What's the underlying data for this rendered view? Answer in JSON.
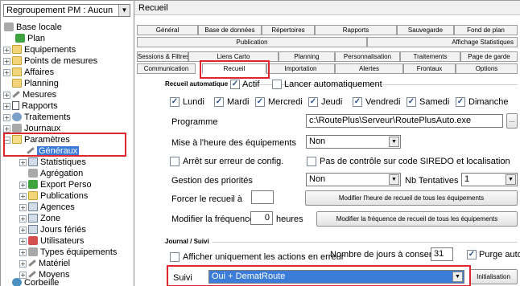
{
  "left": {
    "regroupement": "Regroupement PM : Aucun",
    "tree": [
      {
        "label": "Base locale"
      },
      {
        "label": "Plan"
      },
      {
        "label": "Equipements"
      },
      {
        "label": "Points de mesures"
      },
      {
        "label": "Affaires"
      },
      {
        "label": "Planning"
      },
      {
        "label": "Mesures"
      },
      {
        "label": "Rapports"
      },
      {
        "label": "Traitements"
      },
      {
        "label": "Journaux"
      },
      {
        "label": "Paramètres"
      },
      {
        "label": "Généraux"
      },
      {
        "label": "Statistiques"
      },
      {
        "label": "Agrégation"
      },
      {
        "label": "Export Perso"
      },
      {
        "label": "Publications"
      },
      {
        "label": "Agences"
      },
      {
        "label": "Zone"
      },
      {
        "label": "Jours fériés"
      },
      {
        "label": "Utilisateurs"
      },
      {
        "label": "Types équipements"
      },
      {
        "label": "Matériel"
      },
      {
        "label": "Moyens"
      },
      {
        "label": "Corbeille"
      }
    ]
  },
  "right": {
    "title": "Recueil",
    "tabs_row1": [
      "Général",
      "Base de données",
      "Répertoires",
      "Rapports",
      "Sauvegarde",
      "Fond de plan"
    ],
    "tabs_row2": [
      "Publication",
      "Affichage Statistiques"
    ],
    "tabs_row3": [
      "Sessions & Filtres",
      "Liens Carto",
      "Planning",
      "Personnalisation",
      "Traitements",
      "Page de garde"
    ],
    "tabs_row4": [
      "Communication",
      "Recueil",
      "Importation",
      "Alertes",
      "Frontaux",
      "Options"
    ],
    "recueil_auto": {
      "header": "Recueil automatique",
      "actif": "Actif",
      "lancer": "Lancer automatiquement",
      "days": [
        "Lundi",
        "Mardi",
        "Mercredi",
        "Jeudi",
        "Vendredi",
        "Samedi",
        "Dimanche"
      ],
      "programme_label": "Programme",
      "programme_value": "c:\\RoutePlus\\Serveur\\RoutePlusAuto.exe",
      "browse": "...",
      "mise_label": "Mise à l'heure des équipements",
      "mise_value": "Non",
      "arret": "Arrêt sur erreur de config.",
      "pas_controle": "Pas de contrôle sur code SIREDO et localisation",
      "gestion_label": "Gestion des priorités",
      "gestion_value": "Non",
      "nb_label": "Nb Tentatives",
      "nb_value": "1",
      "forcer_label": "Forcer le recueil à",
      "forcer_value": "",
      "modif_heure_btn": "Modifier l'heure de recueil de tous les équipements",
      "modif_freq_label": "Modifier la fréquence à",
      "modif_freq_value": "0",
      "heures": "heures",
      "modif_freq_btn": "Modifier la fréquence de recueil de tous les équipements"
    },
    "journal": {
      "header": "Journal / Suivi",
      "afficher": "Afficher uniquement les actions en erreur",
      "nb_jours_label": "Nombre de jours à conserver",
      "nb_jours_value": "31",
      "purge": "Purge auto",
      "suivi_label": "Suivi",
      "suivi_value": "Oui + DematRoute",
      "init_btn": "Initialisation"
    }
  },
  "colors": {
    "highlight": "#e0262c",
    "selection": "#3b7cd8"
  }
}
